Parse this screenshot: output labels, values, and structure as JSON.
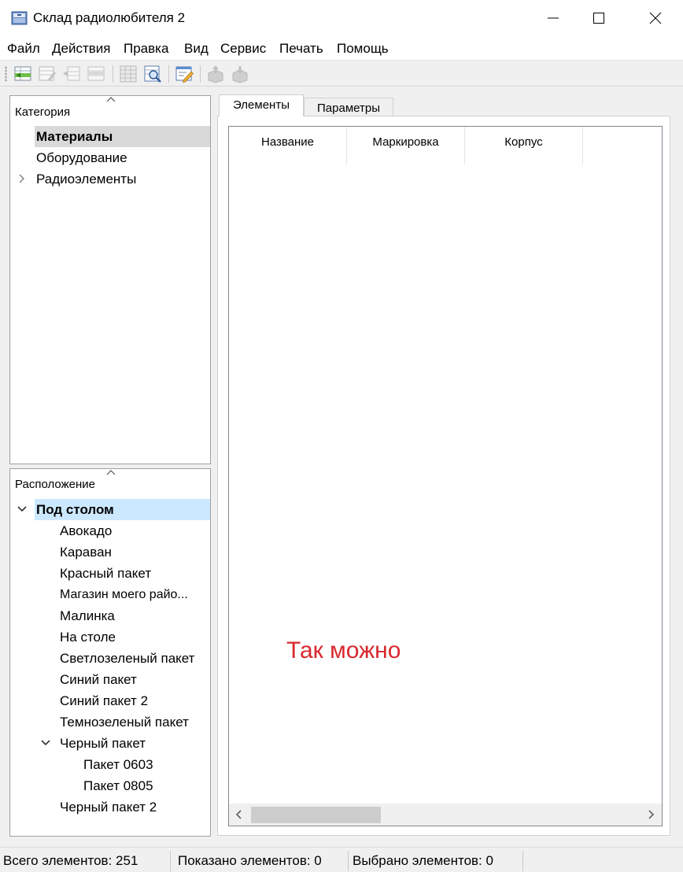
{
  "window": {
    "title": "Склад радиолюбителя 2",
    "icons": {
      "app": "storage-box-icon",
      "minimize": "minimize-icon",
      "maximize": "maximize-icon",
      "close": "close-icon"
    }
  },
  "menu": {
    "items": [
      "Файл",
      "Действия",
      "Правка",
      "Вид",
      "Сервис",
      "Печать",
      "Помощь"
    ]
  },
  "toolbar": {
    "buttons": [
      "add-row-icon",
      "edit-row-icon",
      "split-row-icon",
      "remove-row-icon",
      "table-grid-icon",
      "table-search-icon",
      "edit-form-icon",
      "box-up-icon",
      "box-down-icon"
    ]
  },
  "category_panel": {
    "header": "Категория",
    "items": [
      {
        "label": "Материалы",
        "selected": true
      },
      {
        "label": "Оборудование"
      },
      {
        "label": "Радиоэлементы",
        "collapsed": true
      }
    ]
  },
  "location_panel": {
    "header": "Расположение",
    "items": [
      {
        "label": "Под столом",
        "selected": true,
        "expanded": true
      },
      {
        "label": "Авокадо"
      },
      {
        "label": "Караван"
      },
      {
        "label": "Красный пакет"
      },
      {
        "label": "Магазин моего райо..."
      },
      {
        "label": "Малинка"
      },
      {
        "label": "На столе"
      },
      {
        "label": "Светлозеленый пакет"
      },
      {
        "label": "Синий пакет"
      },
      {
        "label": "Синий пакет 2"
      },
      {
        "label": "Темнозеленый пакет"
      },
      {
        "label": "Черный пакет",
        "expanded": true
      },
      {
        "label": "Пакет 0603"
      },
      {
        "label": "Пакет 0805"
      },
      {
        "label": "Черный пакет 2"
      }
    ]
  },
  "tabs": [
    {
      "label": "Элементы",
      "active": true
    },
    {
      "label": "Параметры"
    }
  ],
  "grid": {
    "columns": [
      "Название",
      "Маркировка",
      "Корпус"
    ],
    "rows": []
  },
  "annotation": "Так можно",
  "status": {
    "total": "Всего элементов: 251",
    "shown": "Показано элементов: 0",
    "selected": "Выбрано элементов: 0"
  },
  "colors": {
    "selection_gray": "#d9d9d9",
    "selection_blue": "#cce8ff",
    "annotation_red": "#d8282d"
  }
}
